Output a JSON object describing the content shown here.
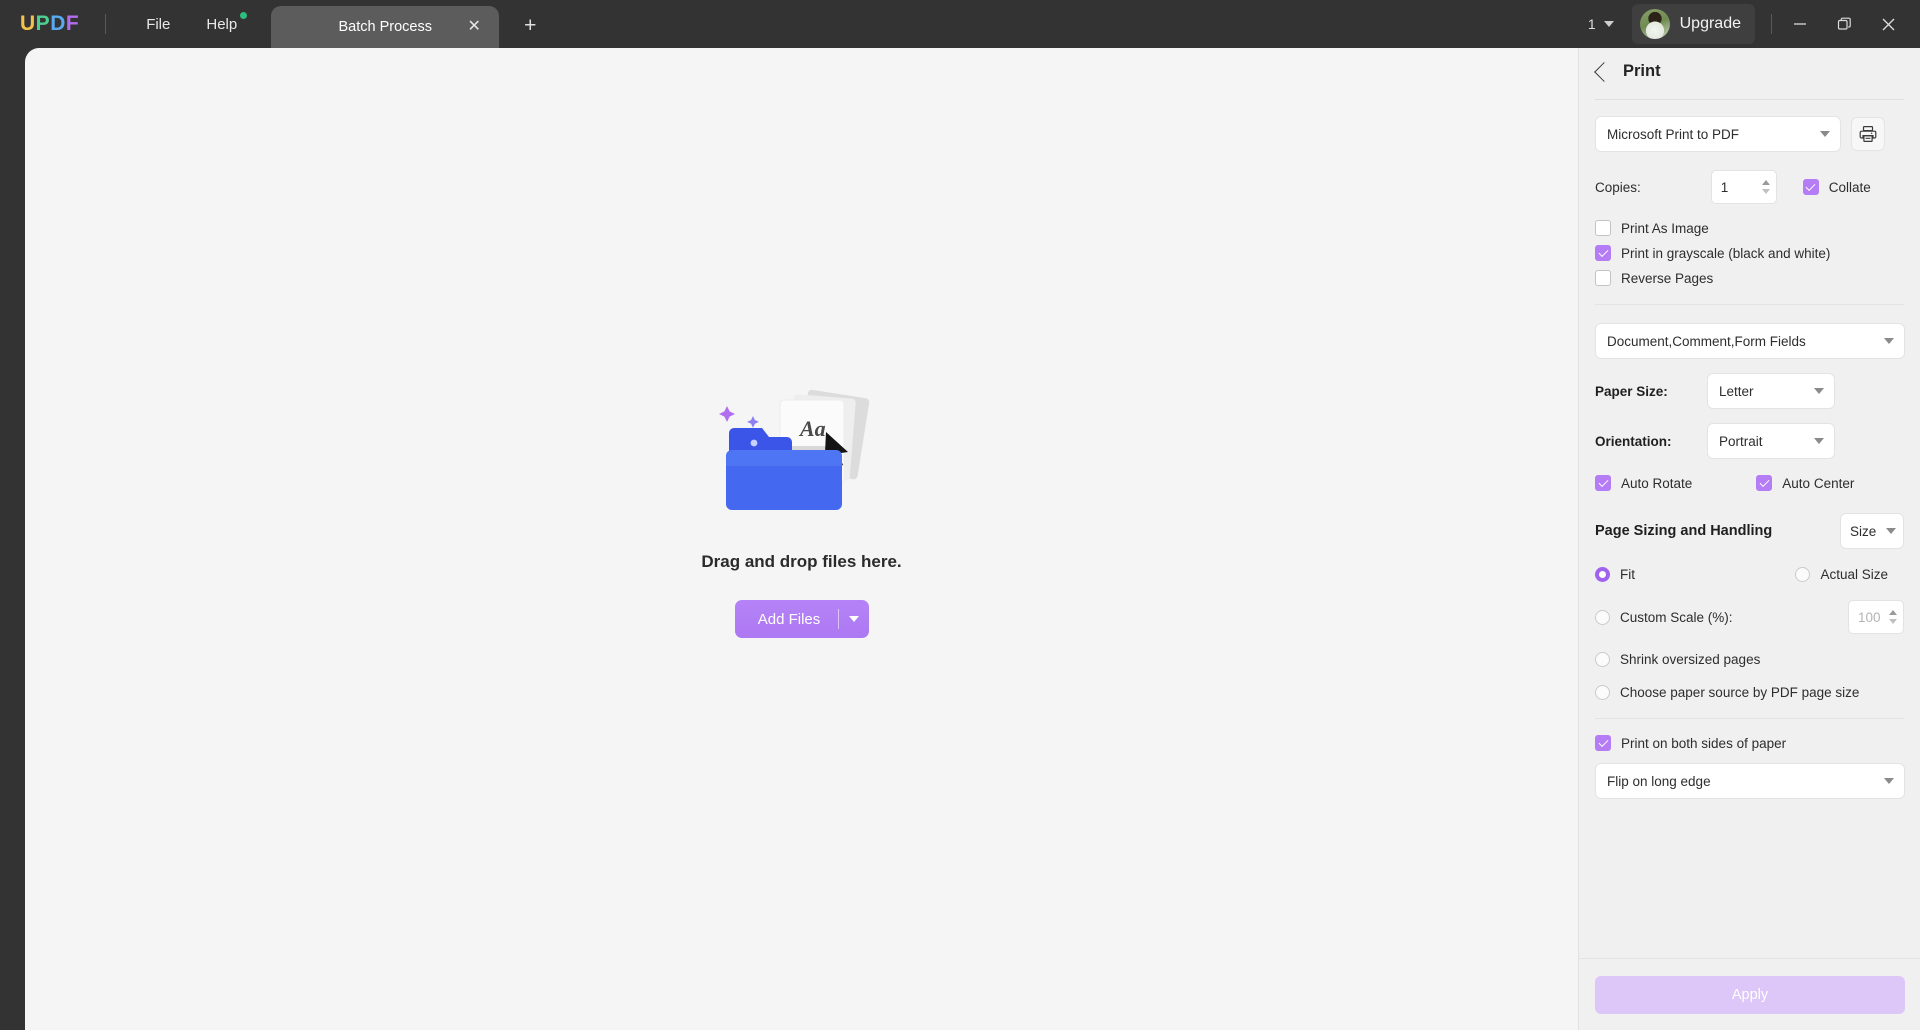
{
  "titlebar": {
    "logo_letters": [
      {
        "ch": "U",
        "color": "#f2c14e"
      },
      {
        "ch": "P",
        "color": "#4dcf8f"
      },
      {
        "ch": "D",
        "color": "#5aa9f0"
      },
      {
        "ch": "F",
        "color": "#b36ef0"
      }
    ],
    "menus": [
      {
        "label": "File",
        "badge": false
      },
      {
        "label": "Help",
        "badge": true
      }
    ],
    "tabs": [
      {
        "label": "Batch Process",
        "close_icon": "✕"
      }
    ],
    "new_tab_icon": "+",
    "page_count": "1",
    "upgrade_label": "Upgrade",
    "window_controls": [
      "minimize",
      "maximize",
      "close"
    ]
  },
  "canvas": {
    "drop_title": "Drag and drop files here.",
    "add_files_label": "Add Files"
  },
  "panel": {
    "title": "Print",
    "back_icon": "chevron-left-icon",
    "printer": {
      "selected": "Microsoft Print to PDF",
      "print_icon": "printer-icon"
    },
    "copies": {
      "label": "Copies:",
      "value": "1",
      "collate_label": "Collate",
      "collate_checked": true
    },
    "options": [
      {
        "label": "Print As Image",
        "checked": false
      },
      {
        "label": "Print in grayscale (black and white)",
        "checked": true
      },
      {
        "label": "Reverse Pages",
        "checked": false
      }
    ],
    "content_select": "Document,Comment,Form Fields",
    "paper_size": {
      "label": "Paper Size:",
      "value": "Letter"
    },
    "orientation": {
      "label": "Orientation:",
      "value": "Portrait"
    },
    "auto_options": [
      {
        "label": "Auto Rotate",
        "checked": true
      },
      {
        "label": "Auto Center",
        "checked": true
      }
    ],
    "page_sizing": {
      "title": "Page Sizing and Handling",
      "mode": "Size",
      "radios": [
        {
          "label": "Fit",
          "selected": true
        },
        {
          "label": "Actual Size",
          "selected": false
        },
        {
          "label": "Custom Scale (%):",
          "selected": false
        },
        {
          "label": "Shrink oversized pages",
          "selected": false
        },
        {
          "label": "Choose paper source by PDF page size",
          "selected": false
        }
      ],
      "custom_scale_value": "100"
    },
    "duplex": {
      "label": "Print on both sides of paper",
      "checked": true,
      "flip_mode": "Flip on long edge"
    },
    "apply_label": "Apply"
  }
}
